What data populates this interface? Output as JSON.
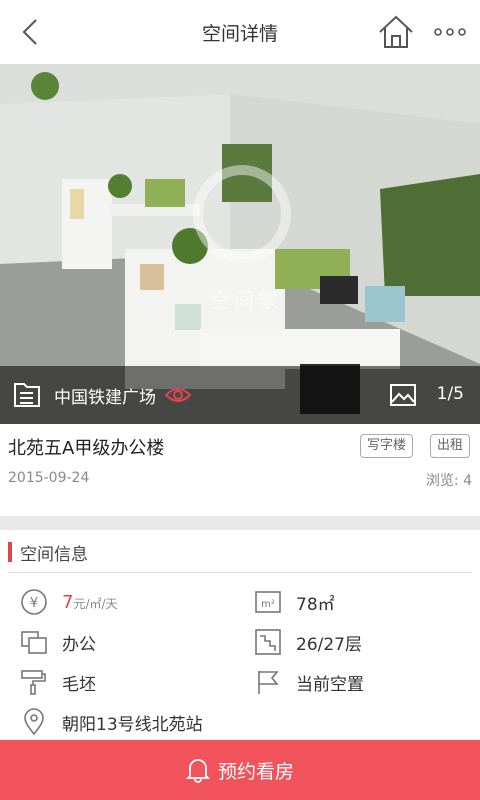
{
  "header": {
    "title": "空间详情"
  },
  "hero": {
    "building": "中国铁建广场",
    "photo_counter": "1/5",
    "watermark": "空间家"
  },
  "listing": {
    "name": "北苑五A甲级办公楼",
    "tags": [
      "写字楼",
      "出租"
    ],
    "date": "2015-09-24",
    "views": "浏览: 4"
  },
  "section": {
    "title": "空间信息",
    "price_value": "7",
    "price_unit": "元/㎡/天",
    "area": "78㎡",
    "usage": "办公",
    "floor": "26/27层",
    "decoration": "毛坯",
    "status": "当前空置",
    "location": "朝阳13号线北苑站"
  },
  "footer": {
    "book_label": "预约看房"
  },
  "colors": {
    "accent": "#e0454f",
    "footer_bg": "#f0535c"
  }
}
